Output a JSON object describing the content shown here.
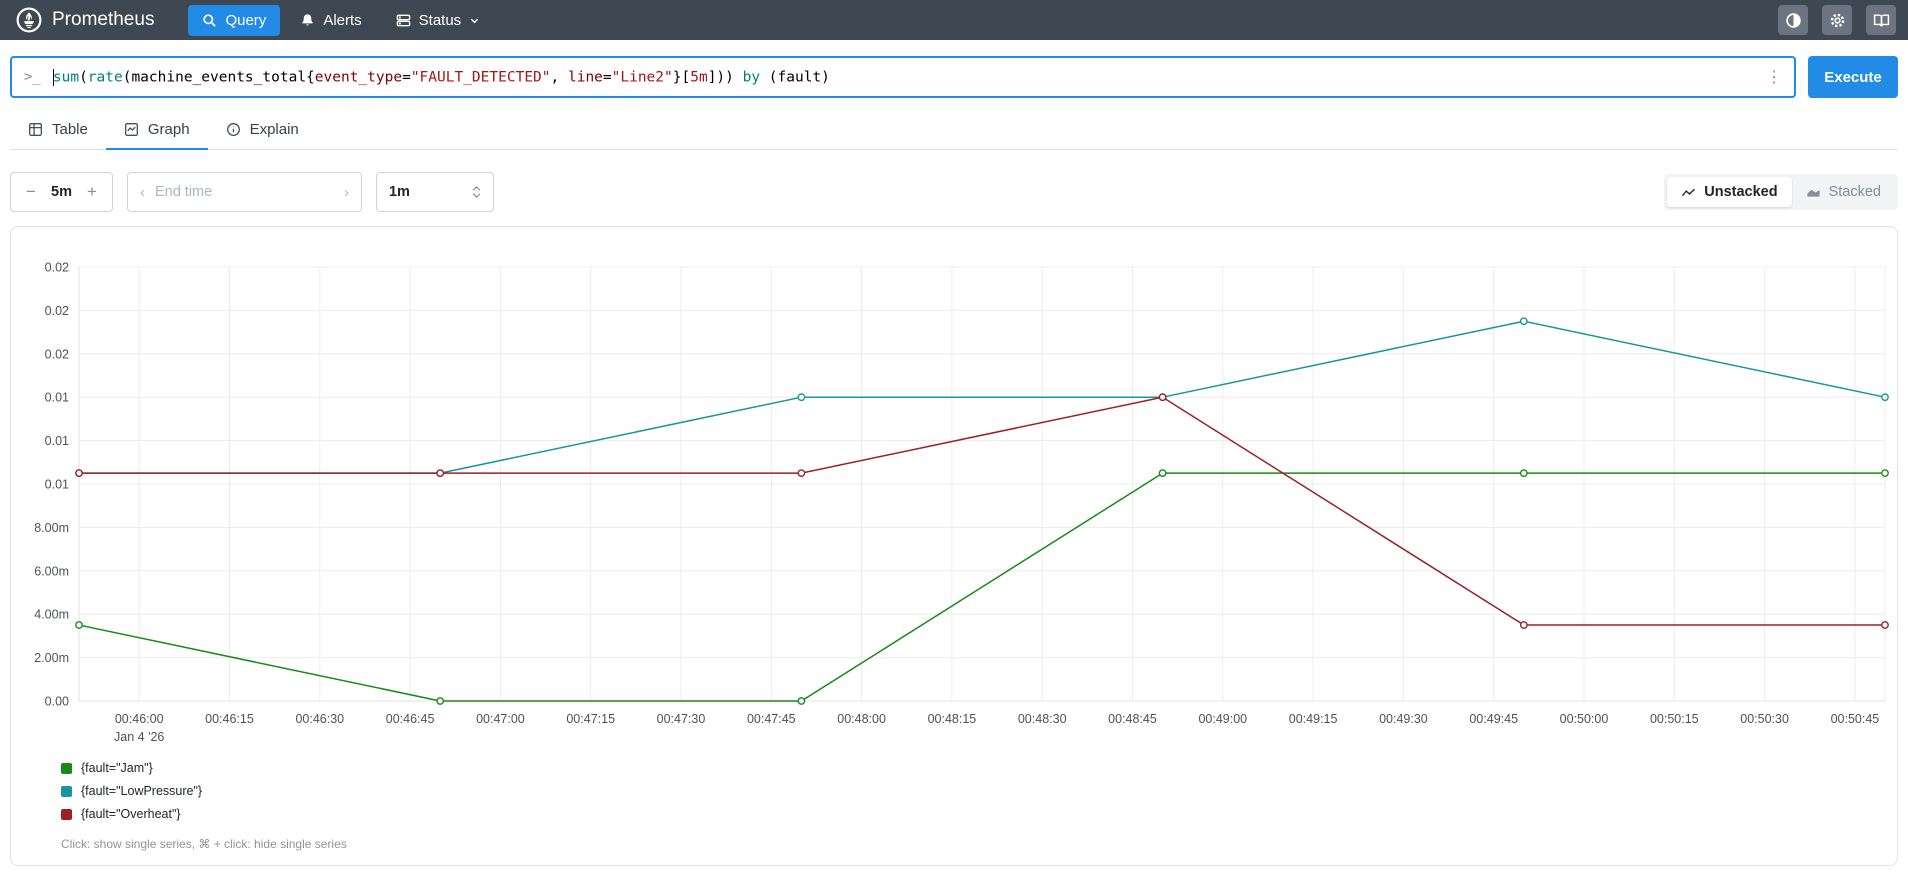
{
  "navbar": {
    "brand": "Prometheus",
    "items": [
      {
        "label": "Query",
        "icon": "search-icon",
        "active": true
      },
      {
        "label": "Alerts",
        "icon": "bell-icon",
        "active": false
      },
      {
        "label": "Status",
        "icon": "server-icon",
        "active": false,
        "trailing_icon": "chevron-down-icon"
      }
    ],
    "right_icons": [
      "theme-contrast-icon",
      "gear-icon",
      "book-icon"
    ],
    "accent_color": "#228be6",
    "background_color": "#3d4852"
  },
  "query_bar": {
    "prompt": ">_",
    "expression": "sum(rate(machine_events_total{event_type=\"FAULT_DETECTED\", line=\"Line2\"}[5m])) by (fault)",
    "tokens": [
      {
        "text": "sum",
        "type": "fn"
      },
      {
        "text": "(",
        "type": "pln"
      },
      {
        "text": "rate",
        "type": "fn"
      },
      {
        "text": "(machine_events_total{",
        "type": "pln"
      },
      {
        "text": "event_type",
        "type": "lbl"
      },
      {
        "text": "=",
        "type": "pln"
      },
      {
        "text": "\"FAULT_DETECTED\"",
        "type": "str"
      },
      {
        "text": ", ",
        "type": "pln"
      },
      {
        "text": "line",
        "type": "lbl"
      },
      {
        "text": "=",
        "type": "pln"
      },
      {
        "text": "\"Line2\"",
        "type": "str"
      },
      {
        "text": "}[",
        "type": "pln"
      },
      {
        "text": "5m",
        "type": "dur"
      },
      {
        "text": "])) ",
        "type": "pln"
      },
      {
        "text": "by",
        "type": "kw"
      },
      {
        "text": " (fault)",
        "type": "pln"
      }
    ],
    "more_icon": "⋮",
    "execute_label": "Execute"
  },
  "tabs": [
    {
      "label": "Table",
      "icon": "table-icon",
      "active": false
    },
    {
      "label": "Graph",
      "icon": "graph-icon",
      "active": true
    },
    {
      "label": "Explain",
      "icon": "info-icon",
      "active": false
    }
  ],
  "controls": {
    "minus": "−",
    "range_value": "5m",
    "plus": "+",
    "prev_chevron": "‹",
    "end_time_placeholder": "End time",
    "next_chevron": "›",
    "resolution_value": "1m",
    "unstacked_label": "Unstacked",
    "stacked_label": "Stacked"
  },
  "chart_data": {
    "type": "line",
    "grid": true,
    "x_axis": {
      "date_label": "Jan 4 '26",
      "window_seconds": 300,
      "start_time": "00:45:50",
      "end_time": "00:50:50",
      "ticks": [
        {
          "sec": 10,
          "label": "00:46:00"
        },
        {
          "sec": 25,
          "label": "00:46:15"
        },
        {
          "sec": 40,
          "label": "00:46:30"
        },
        {
          "sec": 55,
          "label": "00:46:45"
        },
        {
          "sec": 70,
          "label": "00:47:00"
        },
        {
          "sec": 85,
          "label": "00:47:15"
        },
        {
          "sec": 100,
          "label": "00:47:30"
        },
        {
          "sec": 115,
          "label": "00:47:45"
        },
        {
          "sec": 130,
          "label": "00:48:00"
        },
        {
          "sec": 145,
          "label": "00:48:15"
        },
        {
          "sec": 160,
          "label": "00:48:30"
        },
        {
          "sec": 175,
          "label": "00:48:45"
        },
        {
          "sec": 190,
          "label": "00:49:00"
        },
        {
          "sec": 205,
          "label": "00:49:15"
        },
        {
          "sec": 220,
          "label": "00:49:30"
        },
        {
          "sec": 235,
          "label": "00:49:45"
        },
        {
          "sec": 250,
          "label": "00:50:00"
        },
        {
          "sec": 265,
          "label": "00:50:15"
        },
        {
          "sec": 280,
          "label": "00:50:30"
        },
        {
          "sec": 295,
          "label": "00:50:45"
        }
      ]
    },
    "y_axis": {
      "min": 0,
      "max": 0.02,
      "ticks": [
        {
          "v": 0.02,
          "label": "0.02"
        },
        {
          "v": 0.018,
          "label": "0.02"
        },
        {
          "v": 0.016,
          "label": "0.02"
        },
        {
          "v": 0.014,
          "label": "0.01"
        },
        {
          "v": 0.012,
          "label": "0.01"
        },
        {
          "v": 0.01,
          "label": "0.01"
        },
        {
          "v": 0.008,
          "label": "8.00m"
        },
        {
          "v": 0.006,
          "label": "6.00m"
        },
        {
          "v": 0.004,
          "label": "4.00m"
        },
        {
          "v": 0.002,
          "label": "2.00m"
        },
        {
          "v": 0.0,
          "label": "0.00"
        }
      ]
    },
    "samples": {
      "offsets_sec": [
        0,
        60,
        120,
        180,
        240,
        300
      ],
      "times": [
        "00:45:50",
        "00:46:50",
        "00:47:50",
        "00:48:50",
        "00:49:50",
        "00:50:50"
      ]
    },
    "series": [
      {
        "name": "{fault=\"Jam\"}",
        "color": "#178a17",
        "values": [
          0.0035,
          0,
          0,
          0.0105,
          0.0105,
          0.0105
        ]
      },
      {
        "name": "{fault=\"LowPressure\"}",
        "color": "#17969e",
        "values": [
          0.0105,
          0.0105,
          0.014,
          0.014,
          0.0175,
          0.014
        ]
      },
      {
        "name": "{fault=\"Overheat\"}",
        "color": "#9b2026",
        "values": [
          0.0105,
          0.0105,
          0.0105,
          0.014,
          0.0035,
          0.0035
        ]
      }
    ]
  },
  "legend": {
    "items": [
      {
        "label": "{fault=\"Jam\"}",
        "color": "#178a17"
      },
      {
        "label": "{fault=\"LowPressure\"}",
        "color": "#17969e"
      },
      {
        "label": "{fault=\"Overheat\"}",
        "color": "#9b2026"
      }
    ],
    "note": "Click: show single series, ⌘ + click: hide single series"
  }
}
